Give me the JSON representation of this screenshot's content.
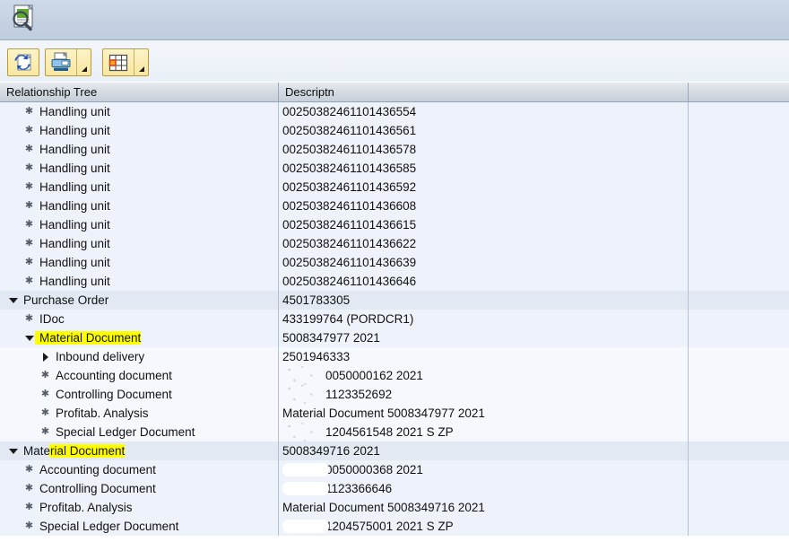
{
  "window": {
    "app_icon": "document-search-icon"
  },
  "toolbar": {
    "buttons": [
      {
        "name": "refresh-button",
        "icon": "refresh-document-icon",
        "has_dropdown": false
      },
      {
        "name": "print-button",
        "icon": "printer-icon",
        "has_dropdown": true
      },
      {
        "name": "layout-button",
        "icon": "grid-layout-icon",
        "has_dropdown": true
      }
    ]
  },
  "grid": {
    "columns": [
      "Relationship Tree",
      "Descriptn",
      ""
    ],
    "rows": [
      {
        "label": "Handling unit",
        "desc": "00250382461101436554",
        "indent": 2,
        "icon": "leaf",
        "band": "b",
        "highlight": "none",
        "redaction": "none"
      },
      {
        "label": "Handling unit",
        "desc": "00250382461101436561",
        "indent": 2,
        "icon": "leaf",
        "band": "b",
        "highlight": "none",
        "redaction": "none"
      },
      {
        "label": "Handling unit",
        "desc": "00250382461101436578",
        "indent": 2,
        "icon": "leaf",
        "band": "b",
        "highlight": "none",
        "redaction": "none"
      },
      {
        "label": "Handling unit",
        "desc": "00250382461101436585",
        "indent": 2,
        "icon": "leaf",
        "band": "b",
        "highlight": "none",
        "redaction": "none"
      },
      {
        "label": "Handling unit",
        "desc": "00250382461101436592",
        "indent": 2,
        "icon": "leaf",
        "band": "b",
        "highlight": "none",
        "redaction": "none"
      },
      {
        "label": "Handling unit",
        "desc": "00250382461101436608",
        "indent": 2,
        "icon": "leaf",
        "band": "b",
        "highlight": "none",
        "redaction": "none"
      },
      {
        "label": "Handling unit",
        "desc": "00250382461101436615",
        "indent": 2,
        "icon": "leaf",
        "band": "b",
        "highlight": "none",
        "redaction": "none"
      },
      {
        "label": "Handling unit",
        "desc": "00250382461101436622",
        "indent": 2,
        "icon": "leaf",
        "band": "b",
        "highlight": "none",
        "redaction": "none"
      },
      {
        "label": "Handling unit",
        "desc": "00250382461101436639",
        "indent": 2,
        "icon": "leaf",
        "band": "b",
        "highlight": "none",
        "redaction": "none"
      },
      {
        "label": "Handling unit",
        "desc": "00250382461101436646",
        "indent": 2,
        "icon": "leaf",
        "band": "b",
        "highlight": "none",
        "redaction": "none"
      },
      {
        "label": "Purchase Order",
        "desc": "4501783305",
        "indent": 1,
        "icon": "expanded",
        "band": "a",
        "highlight": "none",
        "redaction": "none"
      },
      {
        "label": "IDoc",
        "desc": "433199764 (PORDCR1)",
        "indent": 2,
        "icon": "leaf",
        "band": "b",
        "highlight": "none",
        "redaction": "none"
      },
      {
        "label": "Material Document",
        "desc": "5008347977 2021",
        "indent": 2,
        "icon": "expanded",
        "band": "b",
        "highlight": "full",
        "redaction": "none"
      },
      {
        "label": "Inbound delivery",
        "desc": "2501946333",
        "indent": 3,
        "icon": "collapsed",
        "band": "c",
        "highlight": "none",
        "redaction": "none"
      },
      {
        "label": "Accounting document",
        "desc": "0050000162 2021",
        "indent": 3,
        "icon": "leaf",
        "band": "c",
        "highlight": "none",
        "redaction": "smudge"
      },
      {
        "label": "Controlling Document",
        "desc": "1123352692",
        "indent": 3,
        "icon": "leaf",
        "band": "c",
        "highlight": "none",
        "redaction": "smudge"
      },
      {
        "label": "Profitab. Analysis",
        "desc": "Material Document 5008347977 2021",
        "indent": 3,
        "icon": "leaf",
        "band": "c",
        "highlight": "none",
        "redaction": "none"
      },
      {
        "label": "Special Ledger Document",
        "desc": "1204561548 2021 S ZP",
        "indent": 3,
        "icon": "leaf",
        "band": "c",
        "highlight": "none",
        "redaction": "smudge"
      },
      {
        "label": "Material Document",
        "desc": "5008349716 2021",
        "indent": 1,
        "icon": "expanded",
        "band": "a",
        "highlight": "partial",
        "redaction": "none"
      },
      {
        "label": "Accounting document",
        "desc": "0050000368 2021",
        "indent": 2,
        "icon": "leaf",
        "band": "b",
        "highlight": "none",
        "redaction": "whiteout"
      },
      {
        "label": "Controlling Document",
        "desc": "1123366646",
        "indent": 2,
        "icon": "leaf",
        "band": "b",
        "highlight": "none",
        "redaction": "whiteout"
      },
      {
        "label": "Profitab. Analysis",
        "desc": "Material Document 5008349716 2021",
        "indent": 2,
        "icon": "leaf",
        "band": "b",
        "highlight": "none",
        "redaction": "none"
      },
      {
        "label": "Special Ledger Document",
        "desc": "1204575001 2021 S ZP",
        "indent": 2,
        "icon": "leaf",
        "band": "b",
        "highlight": "none",
        "redaction": "whiteout"
      }
    ]
  },
  "colors": {
    "highlight": "#ffff00",
    "toolbar_button": "#f8e7a1",
    "header_bg": "#d3d9e1",
    "row_band_a": "#e2e9f3",
    "row_band_b": "#eef2fa",
    "row_band_c": "#f5f8fd"
  }
}
